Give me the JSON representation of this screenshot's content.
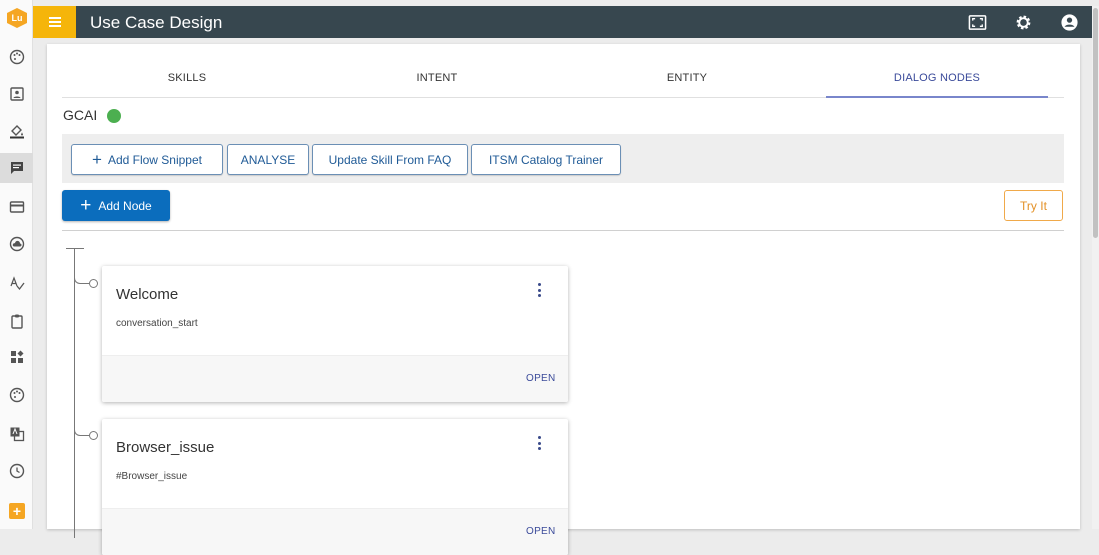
{
  "header": {
    "title": "Use Case Design"
  },
  "sidebar": {
    "logo": "Lu",
    "items": [
      {
        "icon": "palette-icon"
      },
      {
        "icon": "contact-card-icon"
      },
      {
        "icon": "paint-bucket-icon"
      },
      {
        "icon": "chat-icon",
        "active": true
      },
      {
        "icon": "card-icon"
      },
      {
        "icon": "cloud-icon"
      },
      {
        "icon": "spellcheck-icon"
      },
      {
        "icon": "clipboard-icon"
      },
      {
        "icon": "widgets-icon"
      },
      {
        "icon": "palette-icon"
      },
      {
        "icon": "translate-icon"
      },
      {
        "icon": "history-icon"
      }
    ],
    "add": "+"
  },
  "tabs": [
    {
      "label": "SKILLS"
    },
    {
      "label": "INTENT"
    },
    {
      "label": "ENTITY"
    },
    {
      "label": "DIALOG NODES",
      "active": true
    }
  ],
  "skill": {
    "name": "GCAI",
    "status_color": "#4caf50"
  },
  "toolbar": {
    "add_flow_snippet": "Add Flow Snippet",
    "analyse": "ANALYSE",
    "update_skill": "Update Skill From FAQ",
    "itsm": "ITSM Catalog Trainer"
  },
  "actions": {
    "add_node": "Add Node",
    "try_it": "Try It"
  },
  "nodes": [
    {
      "title": "Welcome",
      "condition": "conversation_start",
      "action": "OPEN"
    },
    {
      "title": "Browser_issue",
      "condition": "#Browser_issue",
      "action": "OPEN"
    }
  ],
  "colors": {
    "topbar": "#37474f",
    "accent": "#f5b50a",
    "primary": "#0b6dbd",
    "try_it": "#e39127"
  }
}
